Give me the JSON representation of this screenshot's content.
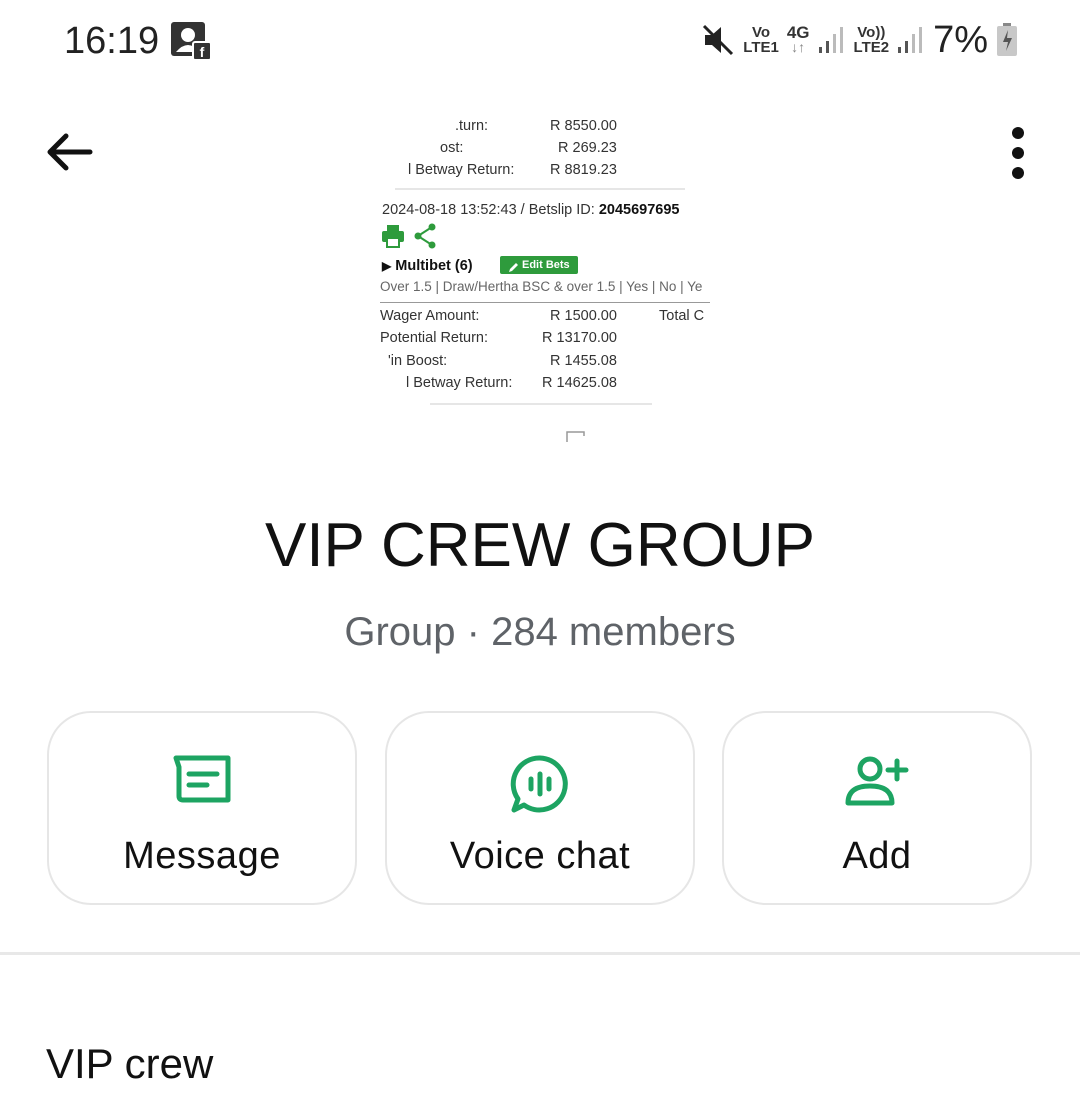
{
  "status_bar": {
    "time": "16:19",
    "sim1": {
      "line1": "Vo",
      "line2": "LTE1"
    },
    "network": "4G",
    "sim2": {
      "line1": "Vo))",
      "line2": "LTE2"
    },
    "battery": "7%",
    "icons": [
      "profile-facebook-icon",
      "mute-icon",
      "signal-icon",
      "battery-charging-icon"
    ]
  },
  "cover_image": {
    "rows": [
      {
        "label": ".turn:",
        "value": "R 8550.00"
      },
      {
        "label": "ost:",
        "value": "R 269.23"
      },
      {
        "label": "l Betway Return:",
        "value": "R 8819.23"
      }
    ],
    "betslip_line": "2024-08-18 13:52:43 / Betslip ID: ",
    "betslip_id": "2045697695",
    "multibet": "Multibet  (6)",
    "edit_bets": "Edit Bets",
    "selections": "Over 1.5 | Draw/Hertha BSC & over 1.5 | Yes | No | Ye",
    "wager_label": "Wager Amount:",
    "wager_value": "R 1500.00",
    "total_label": "Total C",
    "potential_label": "Potential Return:",
    "potential_value": "R 13170.00",
    "boost_label": "'in Boost:",
    "boost_value": "R 1455.08",
    "betway_label": "l Betway Return:",
    "betway_value": "R 14625.08"
  },
  "header": {
    "group_name": "VIP CREW GROUP",
    "group_meta": "Group · 284 members"
  },
  "actions": [
    {
      "label": "Message",
      "icon": "message-icon"
    },
    {
      "label": "Voice chat",
      "icon": "voice-chat-icon"
    },
    {
      "label": "Add",
      "icon": "add-person-icon"
    }
  ],
  "description": "VIP crew",
  "colors": {
    "accent": "#1da462",
    "betway_green": "#2e9b3c"
  }
}
